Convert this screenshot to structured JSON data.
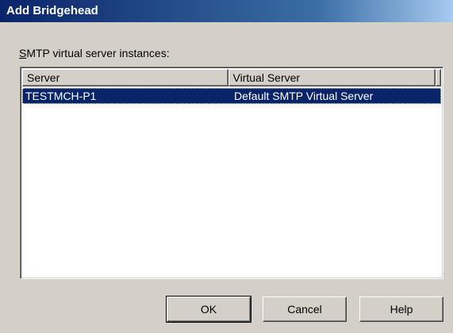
{
  "window": {
    "title": "Add Bridgehead"
  },
  "group": {
    "label_accesskey": "S",
    "label_rest": "MTP virtual server instances:"
  },
  "list": {
    "columns": [
      "Server",
      "Virtual Server"
    ],
    "rows": [
      {
        "server": "TESTMCH-P1",
        "virtual_server": "Default SMTP Virtual Server",
        "selected": true
      }
    ]
  },
  "buttons": {
    "ok": "OK",
    "cancel": "Cancel",
    "help": "Help"
  },
  "colors": {
    "titlebar_start": "#0a246a",
    "selection": "#0a246a",
    "face": "#d4d0c8"
  }
}
